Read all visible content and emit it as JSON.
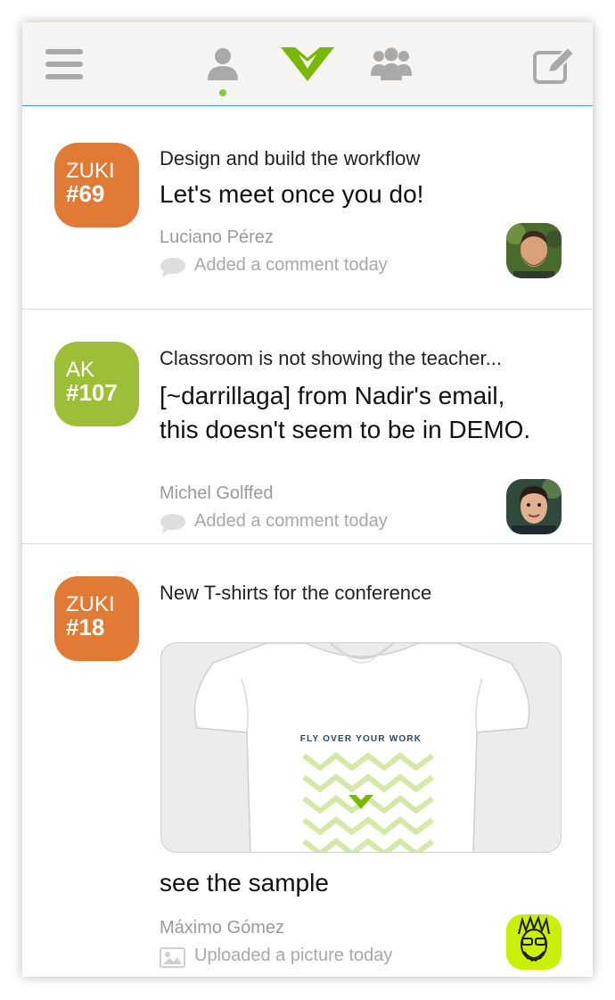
{
  "header": {
    "menu_icon": "hamburger-menu-icon",
    "person_icon": "person-icon",
    "logo_icon": "chevron-logo-icon",
    "group_icon": "group-icon",
    "compose_icon": "compose-icon",
    "accent_color": "#8cc63f"
  },
  "feed": [
    {
      "badge_project": "ZUKI",
      "badge_number": "#69",
      "badge_color": "#e07a35",
      "title": "Design and build the workflow",
      "body": "Let's meet once you do!",
      "author": "Luciano Pérez",
      "activity": "Added a comment today",
      "activity_icon": "comment-icon"
    },
    {
      "badge_project": "AK",
      "badge_number": "#107",
      "badge_color": "#9dbe37",
      "title": "Classroom is not showing the teacher...",
      "body_line1": "[~darrillaga] from Nadir's email,",
      "body_line2": "this doesn't seem to be in DEMO.",
      "author": "Michel Golffed",
      "activity": "Added a comment today",
      "activity_icon": "comment-icon"
    },
    {
      "badge_project": "ZUKI",
      "badge_number": "#18",
      "badge_color": "#e07a35",
      "title": "New T-shirts for the conference",
      "image_text": "FLY OVER YOUR WORK",
      "body": "see the sample",
      "author": "Máximo Gómez",
      "activity": "Uploaded a picture today",
      "activity_icon": "picture-icon"
    }
  ]
}
